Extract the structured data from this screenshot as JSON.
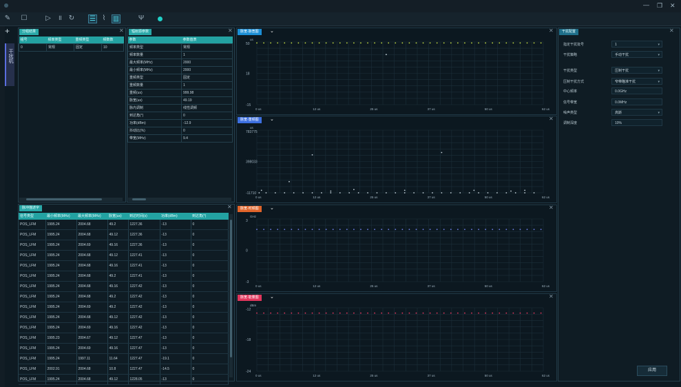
{
  "window": {
    "minimize": "—",
    "maximize": "❐",
    "close": "✕"
  },
  "toolbar": {
    "icons": [
      "pen-icon",
      "square-icon",
      "play-icon",
      "pause-icon",
      "refresh-icon",
      "list-icon",
      "waveform-icon",
      "bar-chart-icon",
      "antenna-icon",
      "record-icon"
    ],
    "record_color": "#21d0c8"
  },
  "side": {
    "add": "+",
    "tab_label": "干扰机"
  },
  "group_panel": {
    "tab": "分组结果",
    "columns": [
      "组号",
      "频率类型",
      "重频类型",
      "频数数"
    ],
    "rows": [
      [
        "0",
        "常规",
        "固定",
        "10"
      ]
    ]
  },
  "param_panel": {
    "tab": "辐射源参数",
    "columns": [
      "参数",
      "参数值表"
    ],
    "rows": [
      [
        "频率类型",
        "常规"
      ],
      [
        "频率数量",
        "1"
      ],
      [
        "最大频率(MHz)",
        "2000"
      ],
      [
        "最小频率(MHz)",
        "2000"
      ],
      [
        "重频类型",
        "固定"
      ],
      [
        "重频数量",
        "1"
      ],
      [
        "重频(us)",
        "999.98"
      ],
      [
        "脉宽(us)",
        "49.19"
      ],
      [
        "脉内调制",
        "线性调频"
      ],
      [
        "到达角(°)",
        "0"
      ],
      [
        "功率(dBm)",
        "-12.9"
      ],
      [
        "抖动比(%)",
        "0"
      ],
      [
        "带宽(MHz)",
        "9.4"
      ]
    ]
  },
  "monitor_panel": {
    "tab": "脉冲描述字",
    "columns": [
      "信号类型",
      "最小频率(MHz)",
      "最大频率(MHz)",
      "脉宽(us)",
      "到达时间(s)",
      "功率(dBm)",
      "到达角(°)"
    ],
    "rows": [
      [
        "POS_LFM",
        "1995.24",
        "2004.68",
        "49.2",
        "1227.36",
        "-13",
        "0"
      ],
      [
        "POS_LFM",
        "1995.24",
        "2004.68",
        "49.12",
        "1227.36",
        "-13",
        "0"
      ],
      [
        "POS_LFM",
        "1995.24",
        "2004.69",
        "49.16",
        "1227.36",
        "-13",
        "0"
      ],
      [
        "POS_LFM",
        "1995.24",
        "2004.68",
        "49.12",
        "1227.41",
        "-13",
        "0"
      ],
      [
        "POS_LFM",
        "1995.24",
        "2004.68",
        "49.16",
        "1227.41",
        "-13",
        "0"
      ],
      [
        "POS_LFM",
        "1995.24",
        "2004.68",
        "49.2",
        "1227.41",
        "-13",
        "0"
      ],
      [
        "POS_LFM",
        "1995.24",
        "2004.68",
        "49.16",
        "1227.42",
        "-13",
        "0"
      ],
      [
        "POS_LFM",
        "1995.24",
        "2004.68",
        "49.2",
        "1227.42",
        "-13",
        "0"
      ],
      [
        "POS_LFM",
        "1995.24",
        "2004.69",
        "49.2",
        "1227.42",
        "-13",
        "0"
      ],
      [
        "POS_LFM",
        "1995.24",
        "2004.68",
        "49.12",
        "1227.42",
        "-13",
        "0"
      ],
      [
        "POS_LFM",
        "1995.24",
        "2004.69",
        "49.16",
        "1227.42",
        "-13",
        "0"
      ],
      [
        "POS_LFM",
        "1995.23",
        "2004.67",
        "49.12",
        "1227.47",
        "-13",
        "0"
      ],
      [
        "POS_LFM",
        "1995.24",
        "2004.69",
        "49.16",
        "1227.47",
        "-13",
        "0"
      ],
      [
        "POS_LFM",
        "1995.24",
        "1997.11",
        "11.64",
        "1227.47",
        "-19.1",
        "0"
      ],
      [
        "POS_LFM",
        "2002.91",
        "2004.68",
        "10.8",
        "1227.47",
        "-14.5",
        "0"
      ],
      [
        "POS_LFM",
        "1995.24",
        "2004.68",
        "49.12",
        "1228.05",
        "-13",
        "0"
      ]
    ]
  },
  "charts": [
    {
      "title": "脉宽-脉宽图",
      "color": "#1c8fd6",
      "unit": "us",
      "yticks": [
        "50",
        "18",
        "-15"
      ],
      "xticks": [
        "0 us",
        "12 us",
        "25 us",
        "37 us",
        "50 us",
        "62 us"
      ]
    },
    {
      "title": "脉宽-重频图",
      "color": "#3c6fe0",
      "unit": "us",
      "yticks": [
        "783775",
        "398033",
        "-11710"
      ],
      "xticks": [
        "0 us",
        "12 us",
        "25 us",
        "37 us",
        "50 us",
        "62 us"
      ]
    },
    {
      "title": "脉宽-时频图",
      "color": "#e0642a",
      "unit": "GHz",
      "yticks": [
        "3",
        "0",
        "-3"
      ],
      "xticks": [
        "0 us",
        "12 us",
        "25 us",
        "37 us",
        "50 us",
        "62 us"
      ]
    },
    {
      "title": "脉宽-能量图",
      "color": "#e0365c",
      "unit": "dBm",
      "yticks": [
        "-12",
        "-18",
        "-24"
      ],
      "xticks": [
        "0 us",
        "12 us",
        "25 us",
        "37 us",
        "50 us",
        "62 us"
      ]
    }
  ],
  "chart_data": [
    {
      "type": "scatter",
      "title": "脉宽-脉宽图",
      "ylabel": "us",
      "ylim": [
        -15,
        50
      ],
      "xlim": [
        0,
        62
      ],
      "series": [
        {
          "color": "#c8e040",
          "x": [
            0,
            1.5,
            3,
            4.5,
            6,
            7.5,
            9,
            10.5,
            12,
            13.5,
            15,
            16.5,
            18,
            19.5,
            21,
            22.5,
            24,
            25.5,
            27,
            28.5,
            30,
            31.5,
            33,
            34.5,
            36,
            37.5,
            39,
            40.5,
            42,
            43.5,
            45,
            46.5,
            48,
            49.5,
            51,
            52.5,
            54,
            55.5,
            57,
            58.5,
            60,
            61.5
          ],
          "y": [
            49,
            49,
            49,
            49,
            49,
            49,
            49,
            49,
            49,
            49,
            49,
            49,
            49,
            49,
            49,
            49,
            49,
            49,
            49,
            49,
            49,
            49,
            49,
            49,
            49,
            49,
            49,
            49,
            49,
            49,
            49,
            49,
            49,
            49,
            49,
            49,
            49,
            49,
            49,
            49,
            49,
            49
          ]
        },
        {
          "color": "#c6d4dc",
          "x": [
            28
          ],
          "y": [
            37
          ]
        }
      ]
    },
    {
      "type": "scatter",
      "title": "脉宽-重频图",
      "ylabel": "us",
      "ylim": [
        -11710,
        783775
      ],
      "xlim": [
        0,
        62
      ],
      "series": [
        {
          "color": "#c6d4dc",
          "x": [
            0.5,
            2,
            4,
            6,
            8,
            10,
            12,
            14,
            16,
            18,
            20,
            22,
            24,
            26,
            28,
            30,
            32,
            34,
            36,
            38,
            40,
            42,
            44,
            46,
            48,
            50,
            52,
            54,
            56,
            58,
            60
          ],
          "y": [
            -11710,
            -11710,
            -11710,
            -11710,
            -11710,
            -11710,
            -11710,
            -11710,
            -11710,
            -11710,
            -11710,
            -11710,
            -11710,
            -11710,
            -11710,
            -11710,
            -11710,
            -11710,
            -11710,
            -11710,
            -11710,
            -11710,
            -11710,
            -11710,
            -11710,
            -11710,
            -11710,
            -11710,
            -11710,
            -11710,
            -11710
          ]
        },
        {
          "color": "#c6d4dc",
          "x": [
            1,
            7,
            12,
            16,
            21,
            32,
            40,
            47,
            55,
            58
          ],
          "y": [
            20000,
            130000,
            470000,
            10000,
            30000,
            20000,
            500000,
            20000,
            10000,
            20000
          ]
        }
      ]
    },
    {
      "type": "scatter",
      "title": "脉宽-时频图",
      "ylabel": "GHz",
      "ylim": [
        -3,
        3
      ],
      "xlim": [
        0,
        62
      ],
      "series": [
        {
          "color": "#6f7fe8",
          "x": [
            0,
            1.5,
            3,
            4.5,
            6,
            7.5,
            9,
            10.5,
            12,
            13.5,
            15,
            16.5,
            18,
            19.5,
            21,
            22.5,
            24,
            25.5,
            27,
            28.5,
            30,
            31.5,
            33,
            34.5,
            36,
            37.5,
            39,
            40.5,
            42,
            43.5,
            45,
            46.5,
            48,
            49.5,
            51,
            52.5,
            54,
            55.5,
            57,
            58.5,
            60,
            61.5
          ],
          "y": [
            2,
            2,
            2,
            2,
            2,
            2,
            2,
            2,
            2,
            2,
            2,
            2,
            2,
            2,
            2,
            2,
            2,
            2,
            2,
            2,
            2,
            2,
            2,
            2,
            2,
            2,
            2,
            2,
            2,
            2,
            2,
            2,
            2,
            2,
            2,
            2,
            2,
            2,
            2,
            2,
            2,
            2
          ]
        }
      ]
    },
    {
      "type": "scatter",
      "title": "脉宽-能量图",
      "ylabel": "dBm",
      "ylim": [
        -24,
        -12
      ],
      "xlim": [
        0,
        62
      ],
      "series": [
        {
          "color": "#e0365c",
          "x": [
            0,
            1.5,
            3,
            4.5,
            6,
            7.5,
            9,
            10.5,
            12,
            13.5,
            15,
            16.5,
            18,
            19.5,
            21,
            22.5,
            24,
            25.5,
            27,
            28.5,
            30,
            31.5,
            33,
            34.5,
            36,
            37.5,
            39,
            40.5,
            42,
            43.5,
            45,
            46.5,
            48,
            49.5,
            51,
            52.5,
            54,
            55.5,
            57,
            58.5,
            60,
            61.5
          ],
          "y": [
            -13,
            -13,
            -13,
            -13,
            -13,
            -13,
            -13,
            -13,
            -13,
            -13,
            -13,
            -13,
            -13,
            -13,
            -13,
            -13,
            -13,
            -13,
            -13,
            -13,
            -13,
            -13,
            -13,
            -13,
            -13,
            -13,
            -13,
            -13,
            -13,
            -13,
            -13,
            -13,
            -13,
            -13,
            -13,
            -13,
            -13,
            -13,
            -13,
            -13,
            -13,
            -13
          ]
        }
      ]
    }
  ],
  "config": {
    "tab": "干扰配置",
    "fields": [
      {
        "label": "指定干扰批号",
        "value": "1",
        "dropdown": true
      },
      {
        "label": "干扰策略",
        "value": "手动干扰",
        "dropdown": true
      },
      {
        "label": "干扰类型",
        "value": "压制干扰",
        "dropdown": true
      },
      {
        "label": "压制干扰方式",
        "value": "窄带瞄准干扰",
        "dropdown": true
      },
      {
        "label": "中心频率",
        "value": "0.0GHz",
        "dropdown": false
      },
      {
        "label": "信号带宽",
        "value": "0.0MHz",
        "dropdown": false
      },
      {
        "label": "噪声类型",
        "value": "高斯",
        "dropdown": true
      },
      {
        "label": "调制深度",
        "value": "10%",
        "dropdown": false
      }
    ],
    "apply": "应用"
  }
}
